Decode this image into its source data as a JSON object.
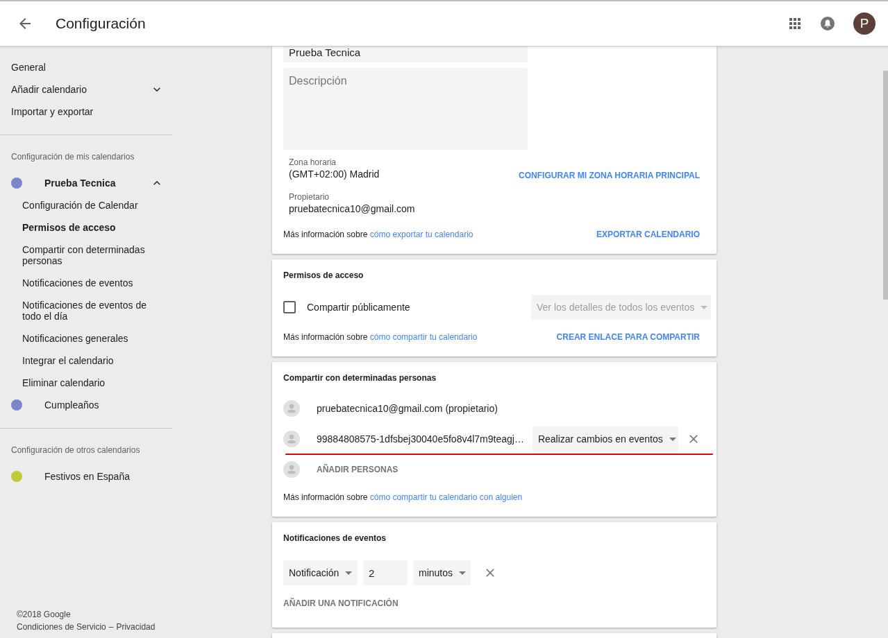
{
  "header": {
    "title": "Configuración",
    "avatar_letter": "P"
  },
  "sidebar": {
    "items": [
      {
        "label": "General",
        "kind": "link"
      },
      {
        "label": "Añadir calendario",
        "kind": "expander",
        "expanded": false
      },
      {
        "label": "Importar y exportar",
        "kind": "link"
      }
    ],
    "sections": [
      {
        "heading": "Configuración de mis calendarios",
        "calendars": [
          {
            "name": "Prueba Tecnica",
            "color": "#7986cb",
            "expanded": true,
            "children": [
              {
                "label": "Configuración de Calendar",
                "selected": false
              },
              {
                "label": "Permisos de acceso",
                "selected": true
              },
              {
                "label": "Compartir con determinadas personas",
                "selected": false
              },
              {
                "label": "Notificaciones de eventos",
                "selected": false
              },
              {
                "label": "Notificaciones de eventos de todo el día",
                "selected": false
              },
              {
                "label": "Notificaciones generales",
                "selected": false
              },
              {
                "label": "Integrar el calendario",
                "selected": false
              },
              {
                "label": "Eliminar calendario",
                "selected": false
              }
            ]
          },
          {
            "name": "Cumpleaños",
            "color": "#7986cb"
          }
        ]
      },
      {
        "heading": "Configuración de otros calendarios",
        "calendars": [
          {
            "name": "Festivos en España",
            "color": "#c0ca33"
          }
        ]
      }
    ],
    "footer": {
      "copyright": "©2018 Google",
      "terms": "Condiciones de Servicio",
      "separator": "–",
      "privacy": "Privacidad"
    }
  },
  "calendar_details": {
    "name_value": "Prueba Tecnica",
    "description_placeholder": "Descripción",
    "timezone": {
      "label": "Zona horaria",
      "value": "(GMT+02:00) Madrid",
      "action": "CONFIGURAR MI ZONA HORARIA PRINCIPAL"
    },
    "owner": {
      "label": "Propietario",
      "value": "pruebatecnica10@gmail.com"
    },
    "info": {
      "prefix": "Más información sobre",
      "link": "cómo exportar tu calendario"
    },
    "action": "EXPORTAR CALENDARIO"
  },
  "access_permissions": {
    "title": "Permisos de acceso",
    "public": {
      "label": "Compartir públicamente",
      "checked": false
    },
    "visibility": {
      "value": "Ver los detalles de todos los eventos",
      "disabled": true
    },
    "info": {
      "prefix": "Más información sobre",
      "link": "cómo compartir tu calendario"
    },
    "action": "CREAR ENLACE PARA COMPARTIR"
  },
  "share_with_people": {
    "title": "Compartir con determinadas personas",
    "people": [
      {
        "kind": "owner",
        "email": "pruebatecnica10@gmail.com (propietario)",
        "highlighted": false
      },
      {
        "kind": "member",
        "email": "99884808575-1dfsbej30040e5fo8v4l7m9teagj…",
        "permission": "Realizar cambios en eventos",
        "highlighted": true
      }
    ],
    "add_label": "AÑADIR PERSONAS",
    "info": {
      "prefix": "Más información sobre",
      "link": "cómo compartir tu calendario con alguien"
    }
  },
  "event_notifications": {
    "title": "Notificaciones de eventos",
    "notifications": [
      {
        "type": "Notificación",
        "amount": "2",
        "unit": "minutos"
      }
    ],
    "add_label": "AÑADIR UNA NOTIFICACIÓN"
  }
}
